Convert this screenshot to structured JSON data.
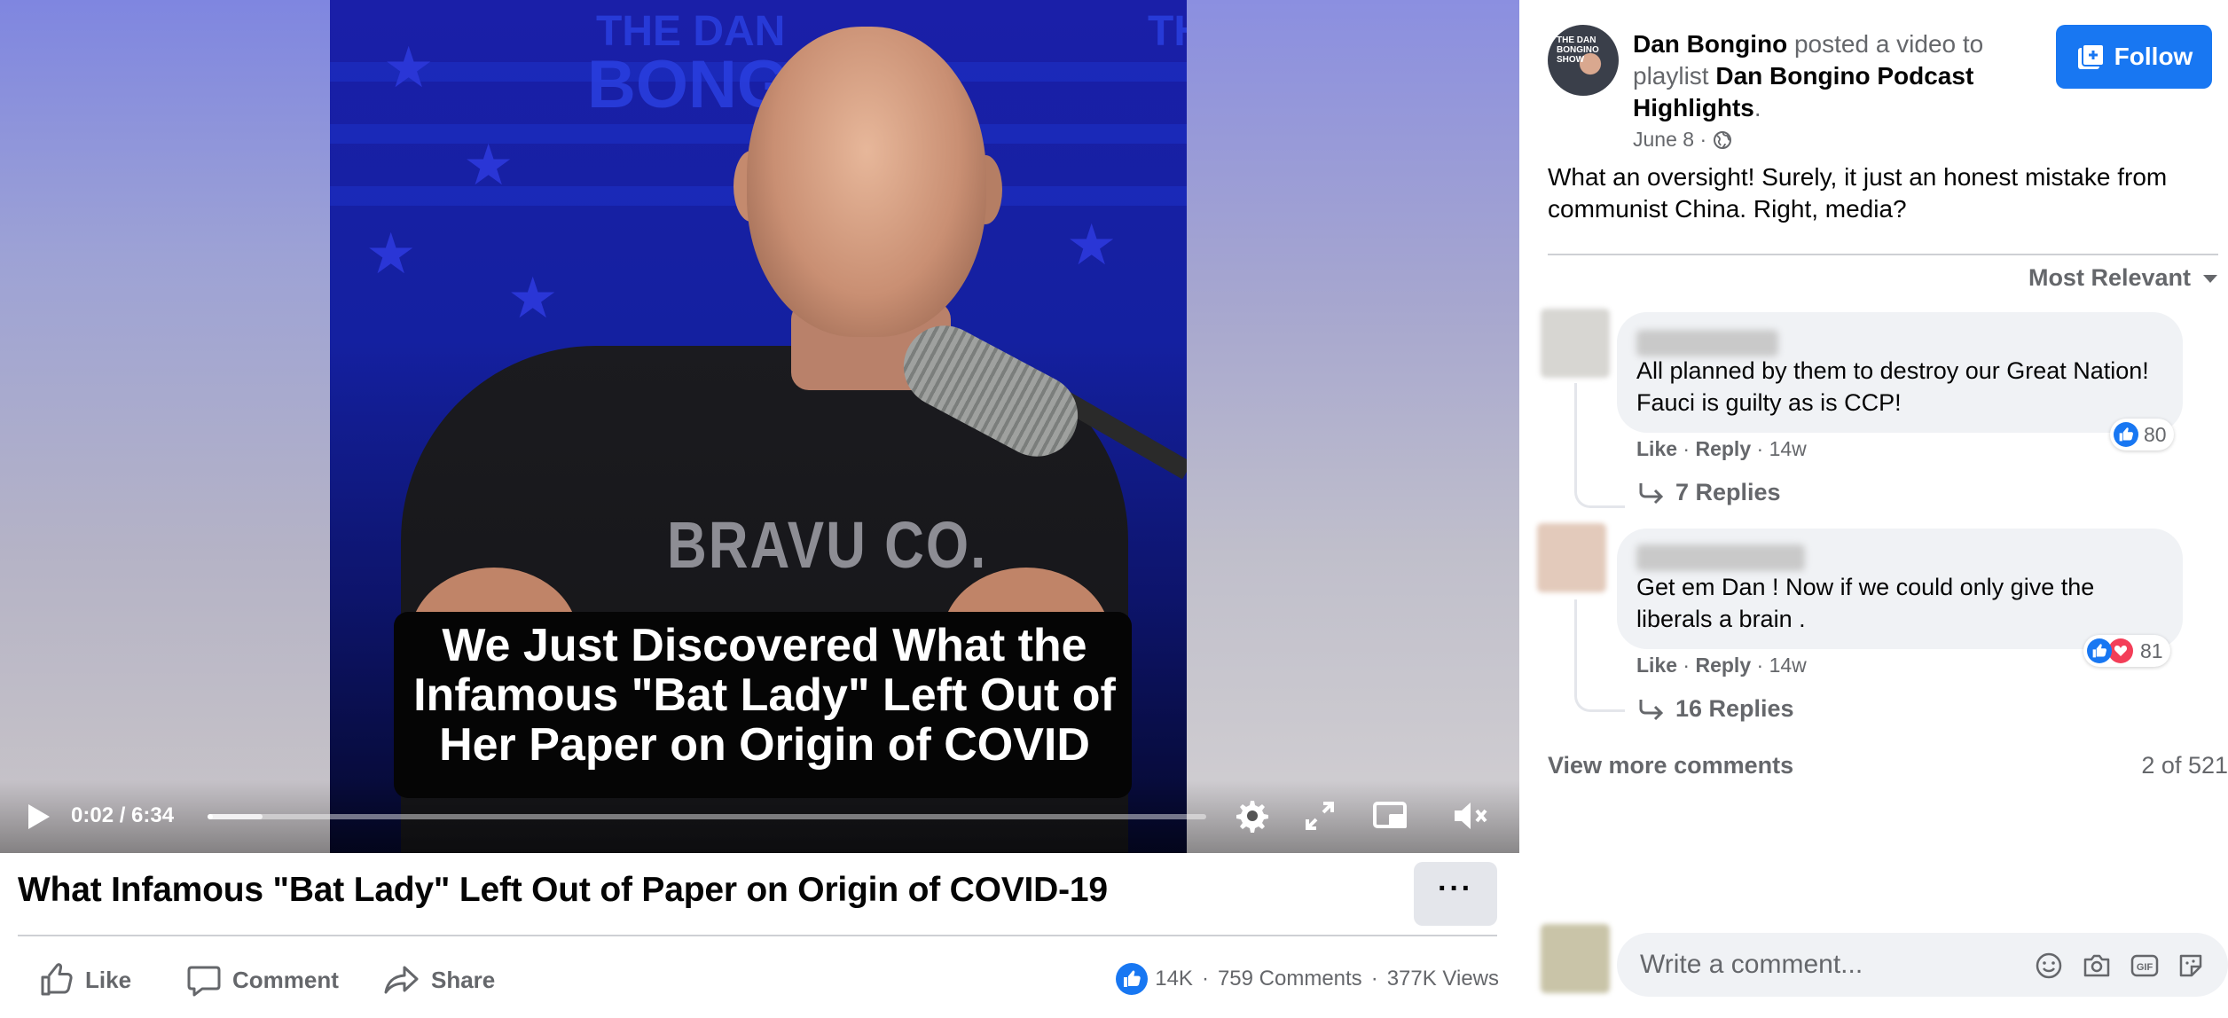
{
  "video": {
    "caption_lines": [
      "We Just Discovered What the",
      "Infamous \"Bat Lady\" Left Out of",
      "Her Paper on Origin of COVID"
    ],
    "shirt_text": "BRAVU CO.",
    "time_display": "0:02 / 6:34",
    "progress_fraction": 0.005,
    "buffered_fraction": 0.055
  },
  "post": {
    "title": "What Infamous \"Bat Lady\" Left Out of Paper on Origin of COVID-19",
    "more_label": "···",
    "actions": {
      "like": "Like",
      "comment": "Comment",
      "share": "Share"
    },
    "stats": {
      "likes": "14K",
      "comments": "759 Comments",
      "views": "377K Views",
      "sep": "·"
    }
  },
  "author": {
    "name": "Dan Bongino",
    "posted_text": " posted a video to playlist ",
    "playlist": "Dan Bongino Podcast Highlights",
    "period": ".",
    "date": "June 8",
    "date_sep": " · ",
    "follow_label": "Follow",
    "avatar_text": "THE DAN BONGINO SHOW"
  },
  "post_text": "What an oversight! Surely, it just an honest mistake from communist China. Right, media?",
  "comments_sort": "Most Relevant",
  "comments": [
    {
      "text": "All planned by them to destroy our Great Nation! Fauci is guilty as is CCP!",
      "like": "Like",
      "reply": "Reply",
      "age": "14w",
      "sep": "·",
      "reactions": "80",
      "replies_label": "7 Replies"
    },
    {
      "text": "Get em Dan ! Now if we could only give the liberals a brain .",
      "like": "Like",
      "reply": "Reply",
      "age": "14w",
      "sep": "·",
      "reactions": "81",
      "replies_label": "16 Replies"
    }
  ],
  "view_more": "View more comments",
  "comment_count": "2 of 521",
  "write_comment": {
    "placeholder": "Write a comment..."
  },
  "colors": {
    "accent": "#1877f2",
    "secondary_text": "#65676b",
    "bubble": "#f0f2f5",
    "love": "#f33e58"
  }
}
